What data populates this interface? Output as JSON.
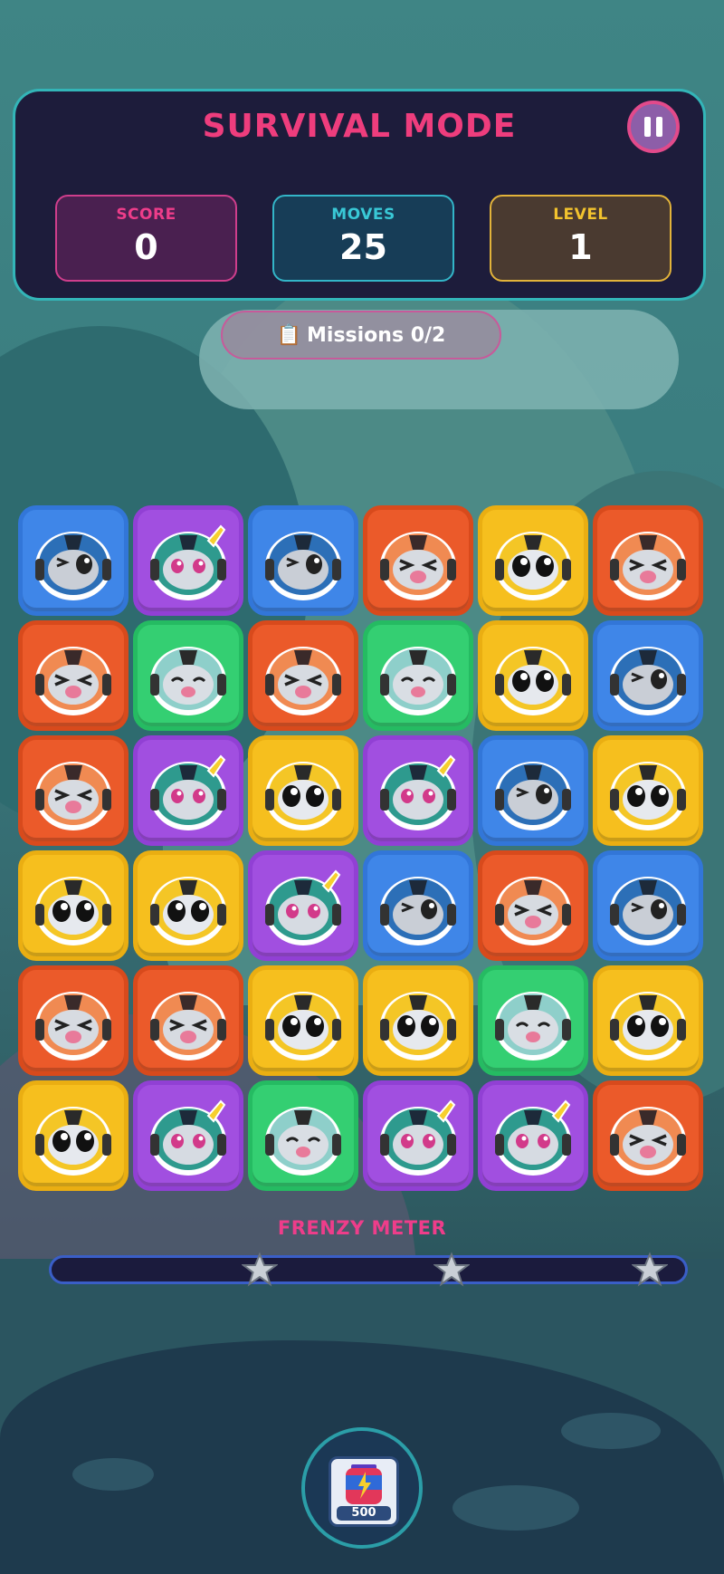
{
  "header": {
    "title": "SURVIVAL MODE",
    "pause_icon": "pause-icon"
  },
  "stats": {
    "score": {
      "label": "SCORE",
      "value": "0"
    },
    "moves": {
      "label": "MOVES",
      "value": "25"
    },
    "level": {
      "label": "LEVEL",
      "value": "1"
    }
  },
  "missions": {
    "icon": "clipboard-icon",
    "emoji": "📋",
    "label": "Missions 0/2"
  },
  "board": {
    "rows": [
      [
        "blue",
        "purple",
        "blue",
        "orange",
        "yellow",
        "orange"
      ],
      [
        "orange",
        "green",
        "orange",
        "green",
        "yellow",
        "blue"
      ],
      [
        "orange",
        "purple",
        "yellow",
        "purple",
        "blue",
        "yellow"
      ],
      [
        "yellow",
        "yellow",
        "purple",
        "blue",
        "orange",
        "blue"
      ],
      [
        "orange",
        "orange",
        "yellow",
        "yellow",
        "green",
        "yellow"
      ],
      [
        "yellow",
        "purple",
        "green",
        "purple",
        "purple",
        "orange"
      ]
    ],
    "colors": {
      "blue": "#3f86e8",
      "purple": "#a14fe0",
      "orange": "#eb5a2a",
      "yellow": "#f6bf1e",
      "green": "#34cf72"
    }
  },
  "frenzy": {
    "label": "FRENZY METER",
    "progress": 0,
    "star_thresholds": [
      0.33,
      0.63,
      0.94
    ]
  },
  "booster": {
    "icon": "battery-booster-icon",
    "price": "500"
  }
}
